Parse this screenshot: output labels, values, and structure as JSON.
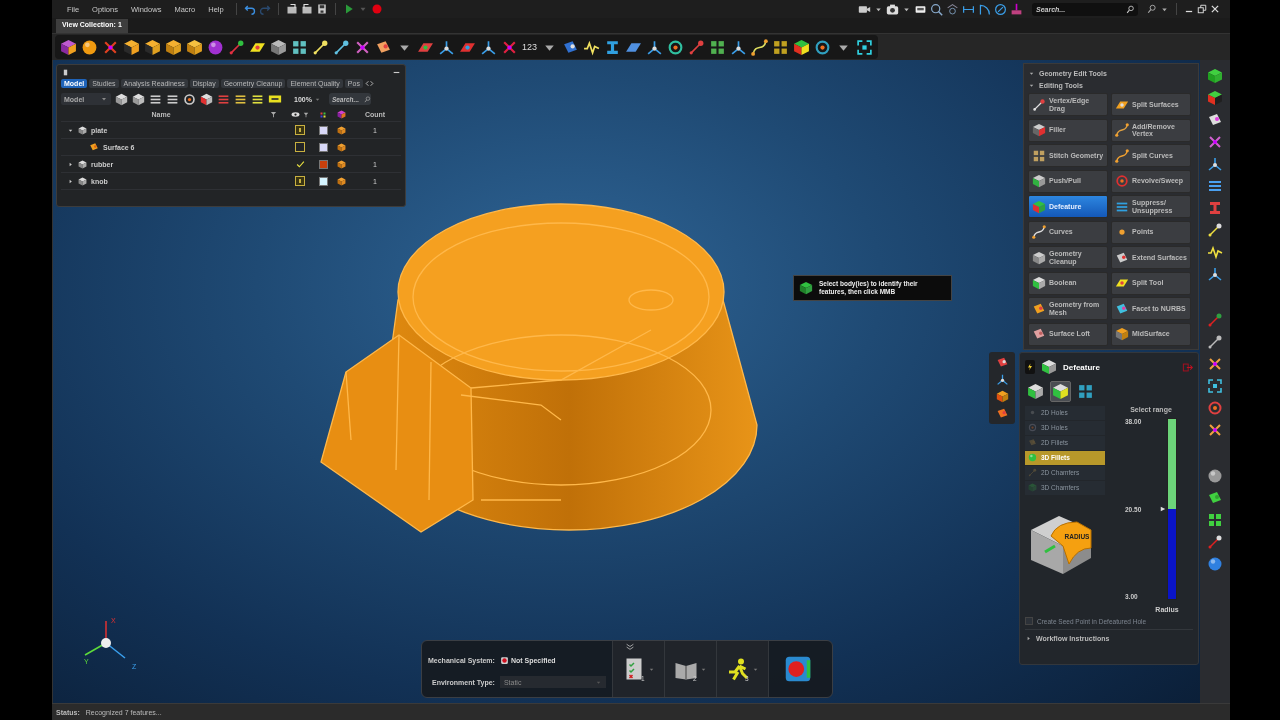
{
  "menu": [
    "File",
    "Options",
    "Windows",
    "Macro",
    "Help"
  ],
  "search": {
    "placeholder": "Search..."
  },
  "view_tabs": [
    {
      "label": "View Collection: 1",
      "selected": true
    }
  ],
  "toolbar": {
    "counter_label": "123"
  },
  "model_browser": {
    "tabs": [
      {
        "label": "Model",
        "selected": true
      },
      {
        "label": "Studies",
        "selected": false
      },
      {
        "label": "Analysis Readiness",
        "selected": false
      },
      {
        "label": "Display",
        "selected": false
      },
      {
        "label": "Geometry Cleanup",
        "selected": false
      },
      {
        "label": "Element Quality",
        "selected": false
      },
      {
        "label": "Pos",
        "selected": false
      }
    ],
    "view_dropdown": "Model",
    "zoom": "100%",
    "search": {
      "placeholder": "Search..."
    },
    "columns": {
      "name": "Name",
      "count": "Count"
    },
    "rows": [
      {
        "name": "plate",
        "count": "1",
        "expanded": true,
        "shown": false,
        "partial": true,
        "color": "#d8d8f8",
        "children": [
          {
            "name": "Surface 6",
            "shown": false,
            "partial": false,
            "color": "#d8d8f8"
          }
        ]
      },
      {
        "name": "rubber",
        "count": "1",
        "expanded": false,
        "shown": true,
        "partial": false,
        "color": "#c8400c"
      },
      {
        "name": "knob",
        "count": "1",
        "expanded": false,
        "shown": false,
        "partial": true,
        "color": "#d4f4ff"
      }
    ]
  },
  "tool_panel": {
    "title": "Geometry Edit Tools",
    "section": "Editing Tools",
    "tools": [
      {
        "label": "Vertex/Edge Drag",
        "selected": false
      },
      {
        "label": "Split Surfaces",
        "selected": false
      },
      {
        "label": "Filler",
        "selected": false
      },
      {
        "label": "Add/Remove Vertex",
        "selected": false
      },
      {
        "label": "Stitch Geometry",
        "selected": false
      },
      {
        "label": "Split Curves",
        "selected": false
      },
      {
        "label": "Push/Pull",
        "selected": false
      },
      {
        "label": "Revolve/Sweep",
        "selected": false
      },
      {
        "label": "Defeature",
        "selected": true
      },
      {
        "label": "Suppress/ Unsuppress",
        "selected": false
      },
      {
        "label": "Curves",
        "selected": false
      },
      {
        "label": "Points",
        "selected": false
      },
      {
        "label": "Geometry Cleanup",
        "selected": false
      },
      {
        "label": "Extend Surfaces",
        "selected": false
      },
      {
        "label": "Boolean",
        "selected": false
      },
      {
        "label": "Split Tool",
        "selected": false
      },
      {
        "label": "Geometry from Mesh",
        "selected": false
      },
      {
        "label": "Facet to NURBS",
        "selected": false
      },
      {
        "label": "Surface Loft",
        "selected": false
      },
      {
        "label": "MidSurface",
        "selected": false
      }
    ]
  },
  "hint": "Select body(ies) to identify their features, then click MMB",
  "defeature": {
    "title": "Defeature",
    "modes": [
      {
        "selected": false
      },
      {
        "selected": true
      },
      {
        "selected": false
      }
    ],
    "feature_types": [
      {
        "label": "2D Holes",
        "selected": false,
        "disabled": true
      },
      {
        "label": "3D Holes",
        "selected": false,
        "disabled": true
      },
      {
        "label": "2D Fillets",
        "selected": false,
        "disabled": true
      },
      {
        "label": "3D Fillets",
        "selected": true,
        "disabled": false
      },
      {
        "label": "2D Chamfers",
        "selected": false,
        "disabled": true
      },
      {
        "label": "3D Chamfers",
        "selected": false,
        "disabled": true
      }
    ],
    "range": {
      "title": "Select range",
      "ticks": [
        "38.00",
        "20.50",
        "3.00"
      ],
      "axis_label": "Radius",
      "level": 0.5
    },
    "diagram_label": "RADIUS",
    "seed_point": {
      "label": "Create Seed Point in Defeatured Hole",
      "checked": false,
      "disabled": true
    },
    "workflow": {
      "label": "Workflow Instructions",
      "expanded": false
    }
  },
  "bottom_panel": {
    "mechanical_system": {
      "label": "Mechanical System:",
      "value": "Not Specified"
    },
    "environment": {
      "label": "Environment Type:",
      "value": "Static",
      "disabled": true
    },
    "steps": [
      {
        "number": "1"
      },
      {
        "number": "2"
      },
      {
        "number": "3"
      }
    ]
  },
  "triad": {
    "x": "X",
    "y": "Y",
    "z": "Z"
  },
  "status_bar": {
    "label": "Status:",
    "message": "Recognized 7 features..."
  }
}
